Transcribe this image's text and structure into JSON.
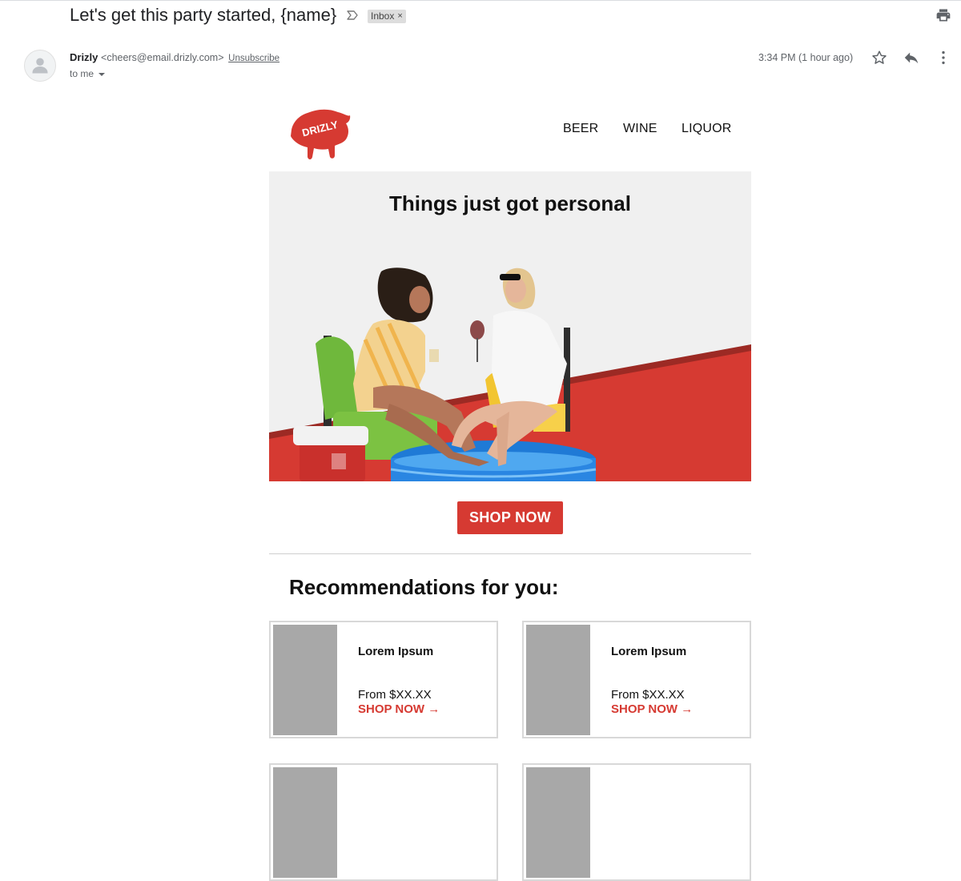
{
  "header": {
    "subject": "Let's get this party started, {name}",
    "label": "Inbox",
    "label_remove": "×"
  },
  "message": {
    "sender_name": "Drizly",
    "sender_email": "<cheers@email.drizly.com>",
    "unsubscribe": "Unsubscribe",
    "recipient": "to me",
    "timestamp": "3:34 PM (1 hour ago)"
  },
  "email": {
    "logo_text": "DRIZLY",
    "nav": [
      "BEER",
      "WINE",
      "LIQUOR"
    ],
    "hero_title": "Things just got personal",
    "cta": "SHOP NOW",
    "recommendations_title": "Recommendations for you:",
    "cards": [
      {
        "name": "Lorem Ipsum",
        "price": "From $XX.XX",
        "cta": "SHOP NOW →"
      },
      {
        "name": "Lorem Ipsum",
        "price": "From $XX.XX",
        "cta": "SHOP NOW →"
      },
      {
        "name": "",
        "price": "",
        "cta": ""
      },
      {
        "name": "",
        "price": "",
        "cta": ""
      }
    ]
  },
  "colors": {
    "brand_red": "#d63a32",
    "hero_bg": "#f0f0f0",
    "placeholder_gray": "#a8a8a8"
  },
  "icons": [
    "label-arrow-icon",
    "print-icon",
    "avatar-icon",
    "star-icon",
    "reply-icon",
    "more-vert-icon",
    "bear-logo-icon",
    "chevron-down-icon"
  ]
}
